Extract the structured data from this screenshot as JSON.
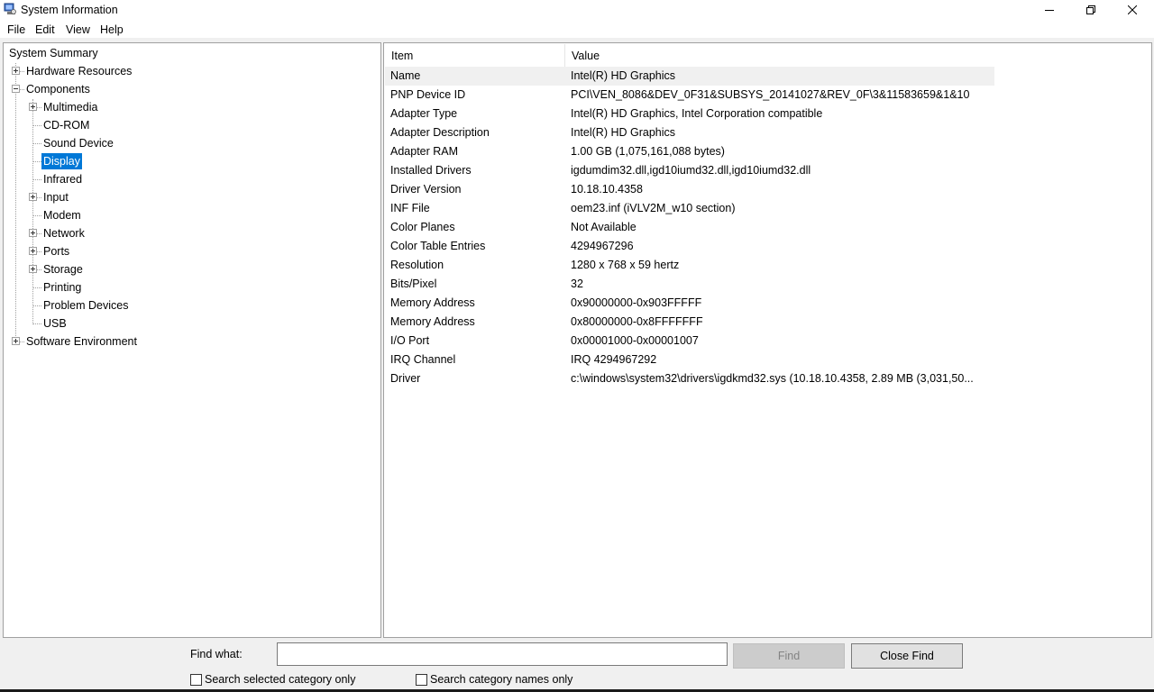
{
  "window": {
    "title": "System Information",
    "icons": {
      "app": "system-info-icon",
      "minimize": "minimize-icon",
      "restore": "restore-icon",
      "close": "close-icon"
    }
  },
  "menu": [
    "File",
    "Edit",
    "View",
    "Help"
  ],
  "tree": {
    "root": "System Summary",
    "hardware": "Hardware Resources",
    "components": "Components",
    "children": [
      {
        "label": "Multimedia",
        "expandable": true
      },
      {
        "label": "CD-ROM",
        "expandable": false
      },
      {
        "label": "Sound Device",
        "expandable": false
      },
      {
        "label": "Display",
        "expandable": false,
        "selected": true
      },
      {
        "label": "Infrared",
        "expandable": false
      },
      {
        "label": "Input",
        "expandable": true
      },
      {
        "label": "Modem",
        "expandable": false
      },
      {
        "label": "Network",
        "expandable": true
      },
      {
        "label": "Ports",
        "expandable": true
      },
      {
        "label": "Storage",
        "expandable": true
      },
      {
        "label": "Printing",
        "expandable": false
      },
      {
        "label": "Problem Devices",
        "expandable": false
      },
      {
        "label": "USB",
        "expandable": false
      }
    ],
    "software": "Software Environment"
  },
  "table": {
    "headers": {
      "item": "Item",
      "value": "Value"
    },
    "rows": [
      {
        "item": "Name",
        "value": "Intel(R) HD Graphics"
      },
      {
        "item": "PNP Device ID",
        "value": "PCI\\VEN_8086&DEV_0F31&SUBSYS_20141027&REV_0F\\3&11583659&1&10"
      },
      {
        "item": "Adapter Type",
        "value": "Intel(R) HD Graphics, Intel Corporation compatible"
      },
      {
        "item": "Adapter Description",
        "value": "Intel(R) HD Graphics"
      },
      {
        "item": "Adapter RAM",
        "value": "1.00 GB (1,075,161,088 bytes)"
      },
      {
        "item": "Installed Drivers",
        "value": "igdumdim32.dll,igd10iumd32.dll,igd10iumd32.dll"
      },
      {
        "item": "Driver Version",
        "value": "10.18.10.4358"
      },
      {
        "item": "INF File",
        "value": "oem23.inf (iVLV2M_w10 section)"
      },
      {
        "item": "Color Planes",
        "value": "Not Available"
      },
      {
        "item": "Color Table Entries",
        "value": "4294967296"
      },
      {
        "item": "Resolution",
        "value": "1280 x 768 x 59 hertz"
      },
      {
        "item": "Bits/Pixel",
        "value": "32"
      },
      {
        "item": "Memory Address",
        "value": "0x90000000-0x903FFFFF"
      },
      {
        "item": "Memory Address",
        "value": "0x80000000-0x8FFFFFFF"
      },
      {
        "item": "I/O Port",
        "value": "0x00001000-0x00001007"
      },
      {
        "item": "IRQ Channel",
        "value": "IRQ 4294967292"
      },
      {
        "item": "Driver",
        "value": "c:\\windows\\system32\\drivers\\igdkmd32.sys (10.18.10.4358, 2.89 MB (3,031,50..."
      }
    ]
  },
  "find": {
    "label": "Find what:",
    "value": "",
    "find_button": "Find",
    "close_button": "Close Find",
    "chk_selected": "Search selected category only",
    "chk_names": "Search category names only"
  }
}
